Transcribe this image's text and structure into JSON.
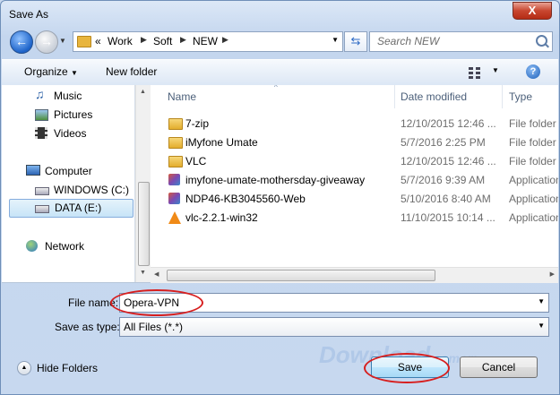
{
  "window": {
    "title": "Save As",
    "close_label": "X"
  },
  "address": {
    "overflow": "«",
    "crumbs": [
      "Work",
      "Soft",
      "NEW"
    ]
  },
  "search": {
    "placeholder": "Search NEW"
  },
  "toolbar": {
    "organize": "Organize",
    "new_folder": "New folder",
    "help": "?"
  },
  "nav": {
    "items": [
      {
        "label": "Music",
        "icon": "music-icon"
      },
      {
        "label": "Pictures",
        "icon": "pictures-icon"
      },
      {
        "label": "Videos",
        "icon": "videos-icon"
      },
      {
        "label": "Computer",
        "icon": "computer-icon"
      },
      {
        "label": "WINDOWS (C:)",
        "icon": "drive-icon"
      },
      {
        "label": "DATA (E:)",
        "icon": "drive-icon",
        "selected": true
      },
      {
        "label": "Network",
        "icon": "network-icon"
      }
    ]
  },
  "columns": {
    "name": "Name",
    "date": "Date modified",
    "type": "Type"
  },
  "files": [
    {
      "name": "7-zip",
      "date": "12/10/2015 12:46 ...",
      "type": "File folder",
      "icon": "folder-icon"
    },
    {
      "name": "iMyfone Umate",
      "date": "5/7/2016 2:25 PM",
      "type": "File folder",
      "icon": "folder-icon"
    },
    {
      "name": "VLC",
      "date": "12/10/2015 12:46 ...",
      "type": "File folder",
      "icon": "folder-icon"
    },
    {
      "name": "imyfone-umate-mothersday-giveaway",
      "date": "5/7/2016 9:39 AM",
      "type": "Application",
      "icon": "installer-icon"
    },
    {
      "name": "NDP46-KB3045560-Web",
      "date": "5/10/2016 8:40 AM",
      "type": "Application",
      "icon": "installer-icon"
    },
    {
      "name": "vlc-2.2.1-win32",
      "date": "11/10/2015 10:14 ...",
      "type": "Application",
      "icon": "vlc-cone-icon"
    }
  ],
  "form": {
    "file_name_label": "File name:",
    "file_name_value": "Opera-VPN",
    "save_type_label": "Save as type:",
    "save_type_value": "All Files (*.*)"
  },
  "footer": {
    "hide_folders": "Hide Folders",
    "save": "Save",
    "cancel": "Cancel"
  },
  "watermark": {
    "text": "Download",
    "suffix": ".com.vn"
  },
  "colors": {
    "accent": "#3c7fb1",
    "highlight_oval": "#d71f1f"
  }
}
